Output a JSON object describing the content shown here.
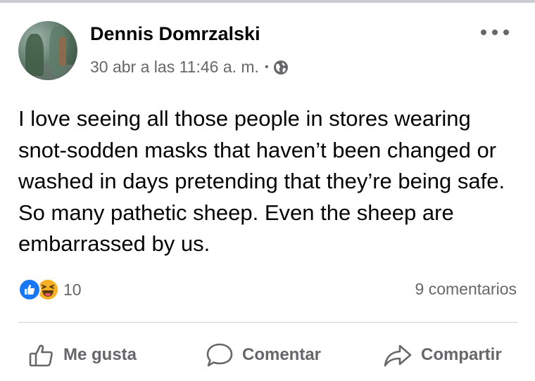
{
  "post": {
    "author": "Dennis Domrzalski",
    "timestamp": "30 abr a las 11:46 a. m.",
    "separator": "•",
    "privacy_icon": "globe-icon",
    "text": "I love seeing all those people in stores wearing snot-sodden masks that haven’t been changed or washed in days pretending that they’re being safe. So many pathetic sheep. Even the sheep are embarrassed by us."
  },
  "reactions": {
    "icons": [
      "like-icon",
      "haha-icon"
    ],
    "count": "10"
  },
  "comments": {
    "label": "9 comentarios"
  },
  "actions": {
    "like": "Me gusta",
    "comment": "Comentar",
    "share": "Compartir"
  },
  "colors": {
    "accent": "#1877f2",
    "secondary_text": "#65676b",
    "haha": "#f7b125"
  }
}
